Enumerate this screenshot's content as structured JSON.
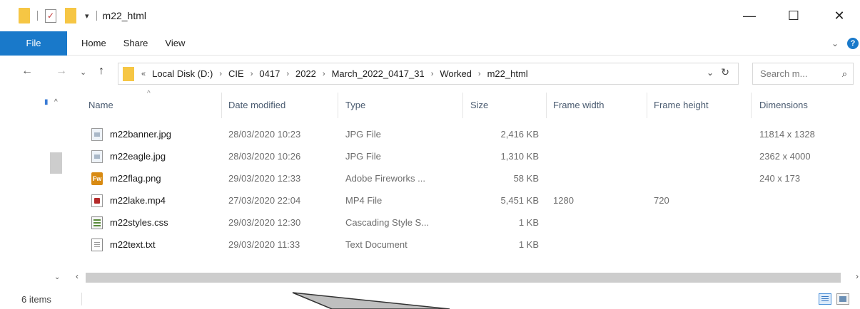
{
  "window": {
    "title": "m22_html",
    "minimize_glyph": "—",
    "maximize_glyph": "☐",
    "close_glyph": "✕"
  },
  "quick_access": {
    "properties_glyph": "✓",
    "dropdown_glyph": "▾"
  },
  "ribbon": {
    "file": "File",
    "tabs": [
      "Home",
      "Share",
      "View"
    ],
    "collapse_glyph": "⌄",
    "help_glyph": "?"
  },
  "nav": {
    "back": "←",
    "forward": "→",
    "recent": "⌄",
    "up": "↑"
  },
  "address": {
    "overflow": "«",
    "crumbs": [
      "Local Disk (D:)",
      "CIE",
      "0417",
      "2022",
      "March_2022_0417_31",
      "Worked",
      "m22_html"
    ],
    "separator": "›",
    "dropdown_glyph": "⌄",
    "refresh_glyph": "↻"
  },
  "search": {
    "placeholder": "Search m...",
    "icon": "⌕"
  },
  "columns": [
    "Name",
    "Date modified",
    "Type",
    "Size",
    "Frame width",
    "Frame height",
    "Dimensions"
  ],
  "sort_glyph": "^",
  "files": [
    {
      "name": "m22banner.jpg",
      "date": "28/03/2020 10:23",
      "type": "JPG File",
      "size": "2,416 KB",
      "frame_width": "",
      "frame_height": "",
      "dimensions": "11814 x 1328",
      "icon": "image-file-icon"
    },
    {
      "name": "m22eagle.jpg",
      "date": "28/03/2020 10:26",
      "type": "JPG File",
      "size": "1,310 KB",
      "frame_width": "",
      "frame_height": "",
      "dimensions": "2362 x 4000",
      "icon": "image-file-icon"
    },
    {
      "name": "m22flag.png",
      "date": "29/03/2020 12:33",
      "type": "Adobe Fireworks ...",
      "size": "58 KB",
      "frame_width": "",
      "frame_height": "",
      "dimensions": "240 x 173",
      "icon": "fireworks-file-icon"
    },
    {
      "name": "m22lake.mp4",
      "date": "27/03/2020 22:04",
      "type": "MP4 File",
      "size": "5,451 KB",
      "frame_width": "1280",
      "frame_height": "720",
      "dimensions": "",
      "icon": "video-file-icon"
    },
    {
      "name": "m22styles.css",
      "date": "29/03/2020 12:30",
      "type": "Cascading Style S...",
      "size": "1 KB",
      "frame_width": "",
      "frame_height": "",
      "dimensions": "",
      "icon": "css-file-icon"
    },
    {
      "name": "m22text.txt",
      "date": "29/03/2020 11:33",
      "type": "Text Document",
      "size": "1 KB",
      "frame_width": "",
      "frame_height": "",
      "dimensions": "",
      "icon": "text-file-icon"
    }
  ],
  "fireworks_badge": "Fw",
  "scroll": {
    "up": "^",
    "down": "⌄",
    "left": "‹",
    "right": "›"
  },
  "status": {
    "item_count": "6 items"
  }
}
